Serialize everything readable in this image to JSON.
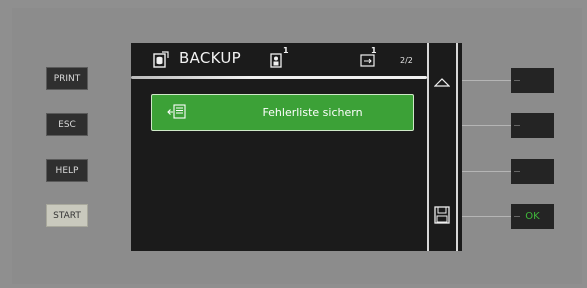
{
  "hardware_buttons": {
    "print": "PRINT",
    "esc": "ESC",
    "help": "HELP",
    "start": "START"
  },
  "screen": {
    "title": "BACKUP",
    "user_badge": "1",
    "usb_badge": "1",
    "page_indicator": "2/2",
    "function_button_label": "Fehlerliste sichern"
  },
  "softkeys": {
    "key1": "",
    "key2": "",
    "key3": "",
    "key4": "OK"
  },
  "colors": {
    "accent_green": "#3ca137",
    "ok_text": "#3fb83a",
    "screen_bg": "#1b1b1b"
  },
  "icons": {
    "title": "database-icon",
    "user": "user-icon",
    "usb": "usb-icon",
    "function": "error-list-save-icon",
    "up": "arrow-up-icon",
    "save": "floppy-disk-icon"
  }
}
